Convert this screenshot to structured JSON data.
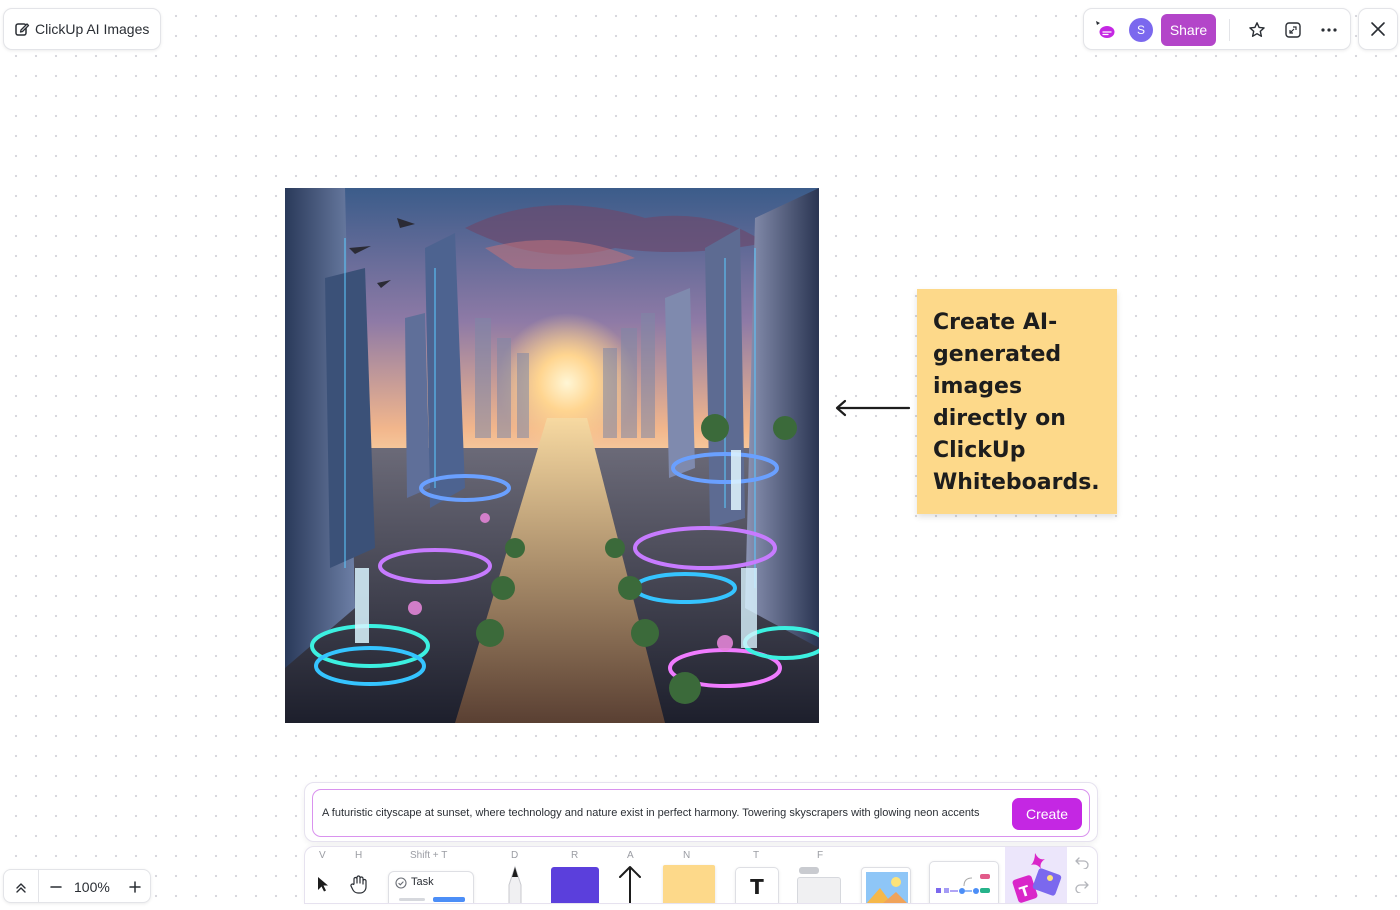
{
  "board": {
    "title": "ClickUp AI Images"
  },
  "header": {
    "avatar_initial": "S",
    "avatar_color": "#7b68ee",
    "share_label": "Share",
    "share_color": "#b345c9"
  },
  "sticky_note": {
    "text": "Create AI-generated images directly on ClickUp Whiteboards.",
    "color": "#fdd98a"
  },
  "prompt": {
    "value": "A futuristic cityscape at sunset, where technology and nature exist in perfect harmony. Towering skyscrapers with glowing neon accents",
    "create_label": "Create",
    "create_color": "#c427e3"
  },
  "toolbar": {
    "shortcuts": {
      "select": "V",
      "hand": "H",
      "task": "Shift + T",
      "draw": "D",
      "rectangle": "R",
      "arrow": "A",
      "note": "N",
      "text": "T",
      "frame": "F"
    },
    "task_label": "Task",
    "text_glyph": "T",
    "shape_color": "#5b3fdc",
    "note_color": "#fdd98a"
  },
  "zoom": {
    "value": "100%"
  },
  "icons": {
    "edit": "edit-pencil-icon",
    "ai": "clickup-ai-icon",
    "favorite": "star-icon",
    "expand": "expand-icon",
    "more": "more-horizontal-icon",
    "close": "close-icon",
    "collapse": "chevron-up-double-icon",
    "zoom_out": "minus-icon",
    "zoom_in": "plus-icon",
    "undo": "undo-icon",
    "redo": "redo-icon"
  }
}
